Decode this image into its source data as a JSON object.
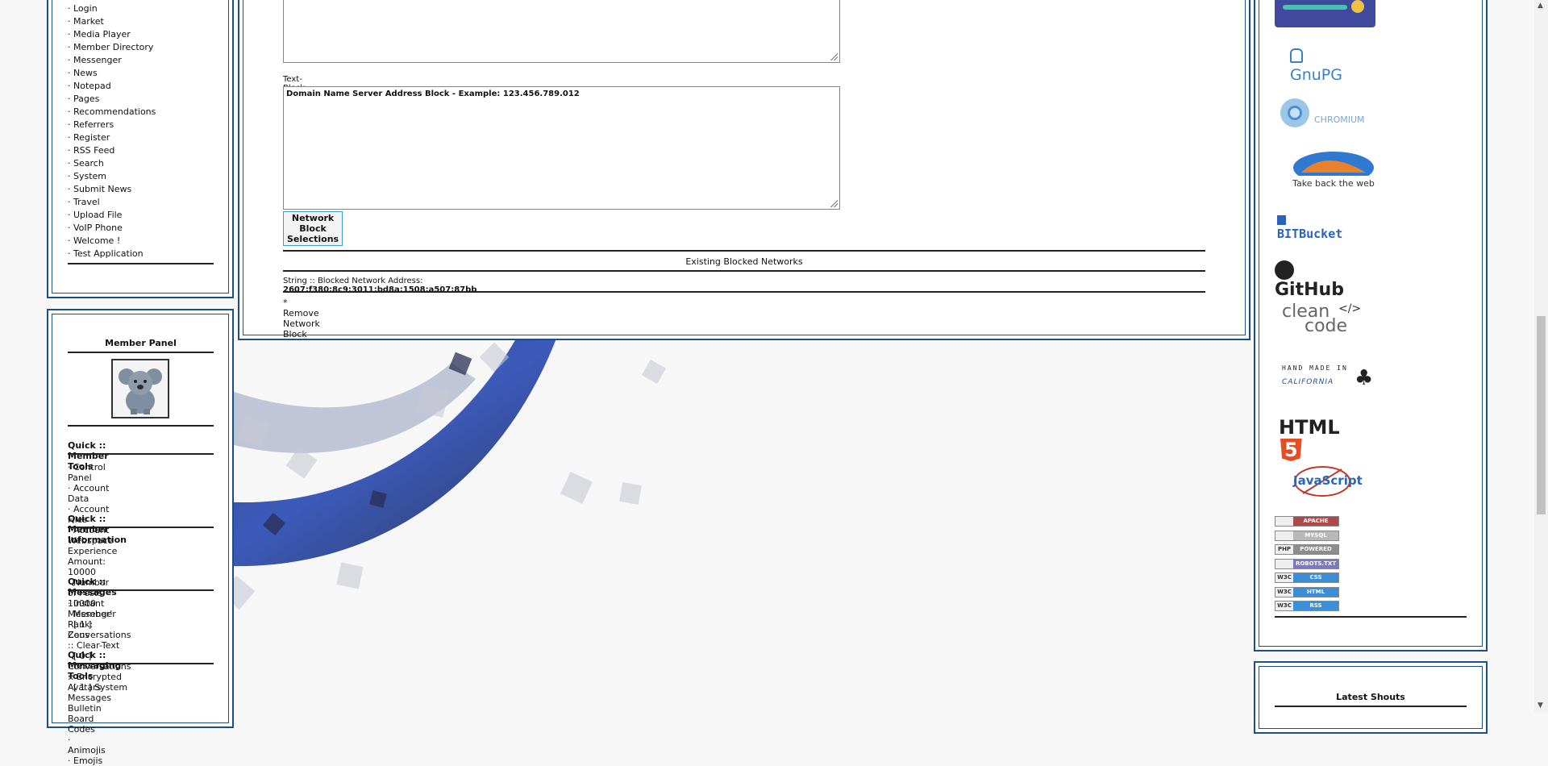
{
  "left_nav": {
    "items": [
      "Login",
      "Market",
      "Media Player",
      "Member Directory",
      "Messenger",
      "News",
      "Notepad",
      "Pages",
      "Recommendations",
      "Referrers",
      "Register",
      "RSS Feed",
      "Search",
      "System",
      "Submit News",
      "Travel",
      "Upload File",
      "VoIP Phone",
      "Welcome !",
      "Test Application"
    ]
  },
  "member_panel": {
    "title": "Member Panel",
    "quick_tools": {
      "title": "Quick :: Member Tools",
      "items": [
        "Control Panel",
        "Account Data",
        "Account Files",
        "Account Webspace"
      ]
    },
    "quick_info": {
      "title": "Quick :: Member Information",
      "items": [
        "Experience Amount: 10000",
        "Number of Posts: 10000",
        "Member' Rank: Zeus"
      ]
    },
    "quick_messages": {
      "title": "Quick :: Messages",
      "items": [
        "Instant Messenger",
        "[ 1 ] Conversations :: Clear-Text",
        "[ 0 ] Conversations :: Encrypted",
        "[ 1 ] System Messages"
      ]
    },
    "quick_msg_tools": {
      "title": "Quick :: Messaging Tools",
      "items": [
        "Avatars",
        "Bulletin Board Codes",
        "Animojis",
        "Emojis"
      ]
    }
  },
  "main": {
    "dns_label": "Text-Block :: Domain Name Server Address",
    "dns_value": "Domain Name Server Address Block - Example: 123.456.789.012",
    "submit_label": "Network Block Selections",
    "existing_title": "Existing Blocked Networks",
    "blocked_prefix": "String :: Blocked Network Address:",
    "blocked_address": "2607:f380:8c9:3011:bd8a:1508:a507:87bb",
    "remove_label": "* Remove Network Block"
  },
  "right": {
    "logos": {
      "gnupg": "GnuPG",
      "chromium": "CHROMIUM",
      "firefox": "Take back the web",
      "bitbucket": "BITBucket",
      "github": "GitHub",
      "cleancode_1": "clean",
      "cleancode_2": "code",
      "california_1": "HAND MADE IN",
      "california_2": "CALIFORNIA",
      "html5": "HTML",
      "html5_num": "5",
      "javascript": "JavaScript"
    },
    "badges": [
      {
        "l": "",
        "r": "APACHE",
        "color": "#b04a4a"
      },
      {
        "l": "",
        "r": "MYSQL",
        "color": "#b8b8b8"
      },
      {
        "l": "PHP",
        "r": "POWERED",
        "color": "#8d8d8d"
      },
      {
        "l": "",
        "r": "ROBOTS.TXT",
        "color": "#7c78c8"
      },
      {
        "l": "W3C",
        "r": "CSS",
        "color": "#3a8fd8"
      },
      {
        "l": "W3C",
        "r": "HTML",
        "color": "#3a8fd8"
      },
      {
        "l": "W3C",
        "r": "RSS",
        "color": "#3a8fd8"
      }
    ],
    "shouts_title": "Latest Shouts"
  },
  "colors": {
    "border": "#1c4f82",
    "textarea_border": "#3aa0c8",
    "link_blue": "#1c7cc0"
  }
}
